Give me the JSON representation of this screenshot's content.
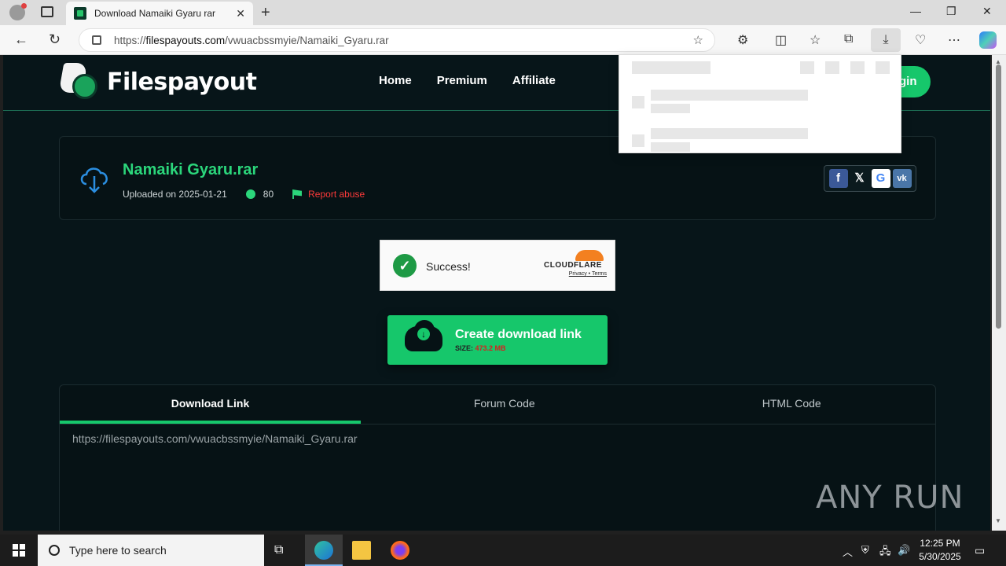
{
  "browser": {
    "tab_title": "Download Namaiki Gyaru rar",
    "url_prefix": "https://",
    "url_host": "filespayouts.com",
    "url_path": "/vwuacbssmyie/Namaiki_Gyaru.rar"
  },
  "site": {
    "logo_text": "Filespayout",
    "nav": [
      "Home",
      "Premium",
      "Affiliate"
    ],
    "login_label": "gin"
  },
  "file": {
    "name": "Namaiki Gyaru.rar",
    "uploaded": "Uploaded on 2025-01-21",
    "downloads": "80",
    "report": "Report abuse"
  },
  "captcha": {
    "status": "Success!",
    "brand": "CLOUDFLARE",
    "privacy": "Privacy",
    "sep": " • ",
    "terms": "Terms"
  },
  "download_button": {
    "title": "Create download link",
    "size_label": "SIZE: ",
    "size_value": "473.2 MB"
  },
  "code_tabs": {
    "tabs": [
      "Download Link",
      "Forum Code",
      "HTML Code"
    ],
    "active": "Download Link",
    "link": "https://filespayouts.com/vwuacbssmyie/Namaiki_Gyaru.rar"
  },
  "watermark": "ANY RUN",
  "taskbar": {
    "search_placeholder": "Type here to search",
    "time": "12:25 PM",
    "date": "5/30/2025"
  },
  "colors": {
    "accent": "#16c76b",
    "page_bg": "#071519",
    "report": "#ff3a3a"
  }
}
